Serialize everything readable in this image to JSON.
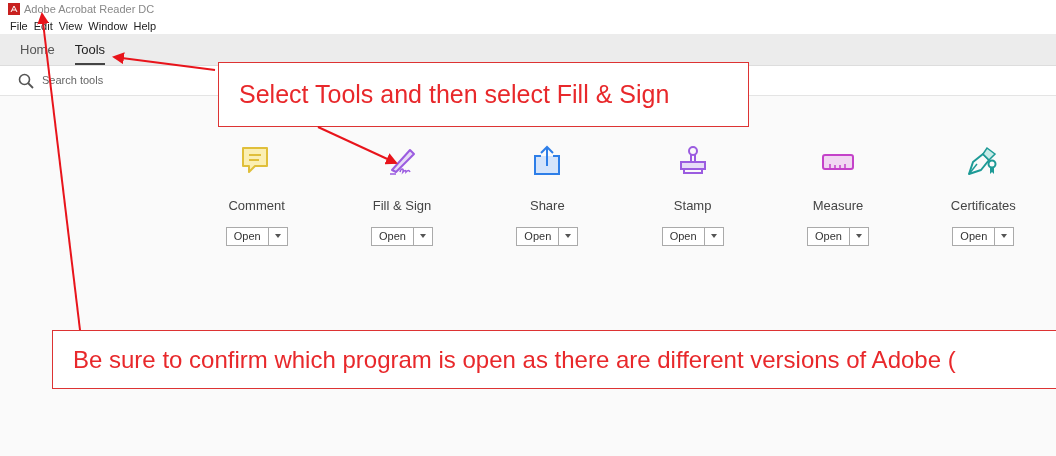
{
  "window": {
    "title": "Adobe Acrobat Reader DC"
  },
  "menu": [
    "File",
    "Edit",
    "View",
    "Window",
    "Help"
  ],
  "tabs": [
    {
      "label": "Home",
      "selected": false
    },
    {
      "label": "Tools",
      "selected": true
    }
  ],
  "search": {
    "placeholder": "Search tools"
  },
  "tools": [
    {
      "kind": "comment",
      "label": "Comment",
      "button": "Open"
    },
    {
      "kind": "sign",
      "label": "Fill & Sign",
      "button": "Open"
    },
    {
      "kind": "share",
      "label": "Share",
      "button": "Open"
    },
    {
      "kind": "stamp",
      "label": "Stamp",
      "button": "Open"
    },
    {
      "kind": "measure",
      "label": "Measure",
      "button": "Open"
    },
    {
      "kind": "certificates",
      "label": "Certificates",
      "button": "Open"
    }
  ],
  "callouts": [
    "Select Tools and then select Fill & Sign",
    "Be sure to confirm which program is open as there are different versions of Adobe ("
  ]
}
